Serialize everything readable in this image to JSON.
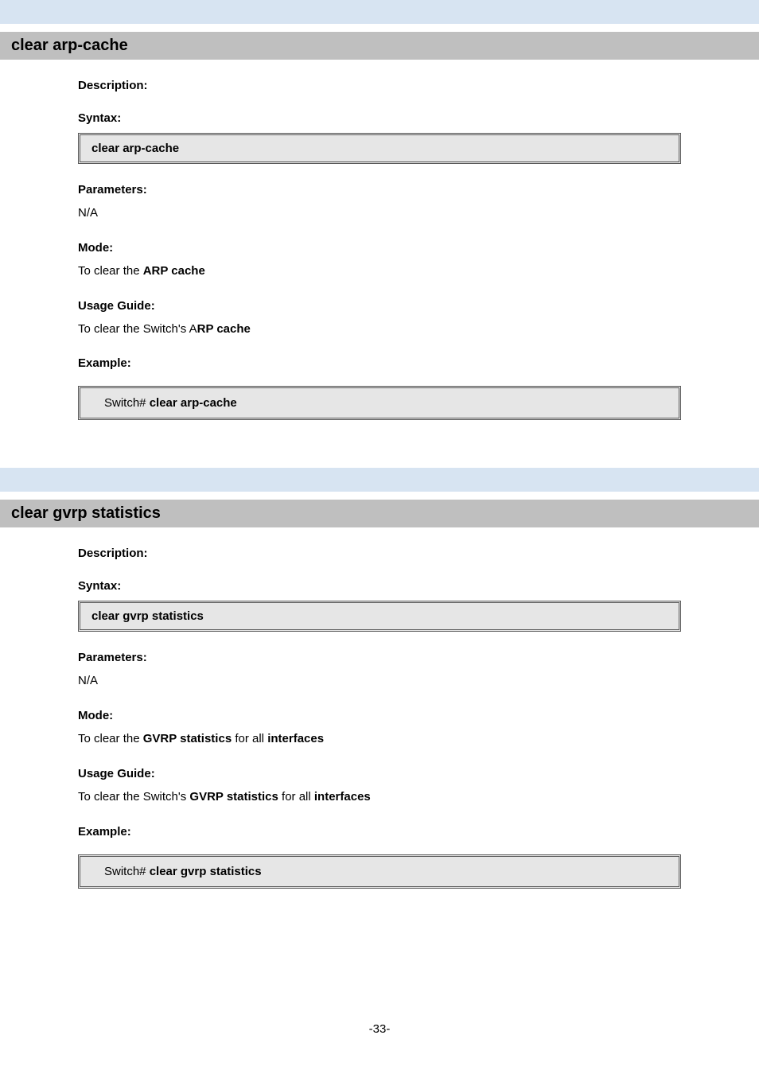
{
  "s1": {
    "title": "clear arp-cache",
    "subhead_desc": "Description:",
    "subhead_syntax": "Syntax:",
    "syntax": "clear arp-cache",
    "subhead_param": "Parameters:",
    "param_text": "N/A",
    "subhead_mode": "Mode:",
    "mode_text_pre": "To clear the ",
    "mode_text_bold": "ARP cache",
    "subhead_usage": "Usage Guide:",
    "usage_pre": "To clear the Switch's A",
    "usage_bold": "RP cache",
    "subhead_example": "Example:",
    "cli_prompt": "Switch#",
    "cli_cmd": " clear arp-cache"
  },
  "s2": {
    "title": "clear gvrp statistics",
    "subhead_desc": "Description:",
    "subhead_syntax": "Syntax:",
    "syntax": "clear gvrp statistics",
    "subhead_param": "Parameters:",
    "param_text": "N/A",
    "subhead_mode": "Mode:",
    "mode_text_pre": "To clear the ",
    "mode_text_bold": "GVRP statistics",
    "mode_text_post": " for all ",
    "mode_text_bold2": "interfaces",
    "subhead_usage": "Usage Guide:",
    "usage_pre": "To clear the Switch's ",
    "usage_bold": "GVRP statistics",
    "usage_post": " for all ",
    "usage_bold2": "interfaces",
    "subhead_example": "Example:",
    "cli_prompt": "Switch#",
    "cli_cmd": " clear gvrp statistics"
  },
  "page_num": "-33-"
}
